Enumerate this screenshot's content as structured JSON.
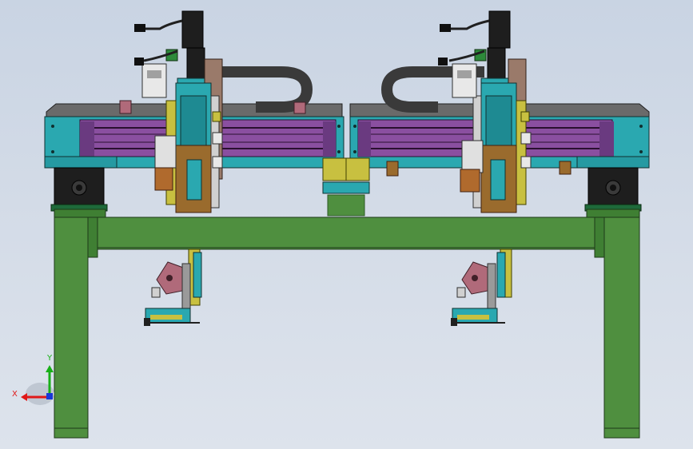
{
  "viewport": {
    "background_top": "#c9d4e3",
    "background_bottom": "#dde3ec"
  },
  "colors": {
    "frame_green": "#4f8f3f",
    "frame_green_dark": "#2d5a24",
    "rail_cyan": "#2aa8b0",
    "cover_gray": "#6e6e6e",
    "slot_purple": "#8a4fa0",
    "carriage_brown": "#9a6b2d",
    "motor_black": "#1e1e1e",
    "sensor_yellow": "#c8c040",
    "gripper_mauve": "#b06a7a",
    "axis_x": "#e01818",
    "axis_y": "#18b018",
    "axis_z": "#1838d8"
  },
  "triad": {
    "x_label": "X",
    "y_label": "Y"
  }
}
